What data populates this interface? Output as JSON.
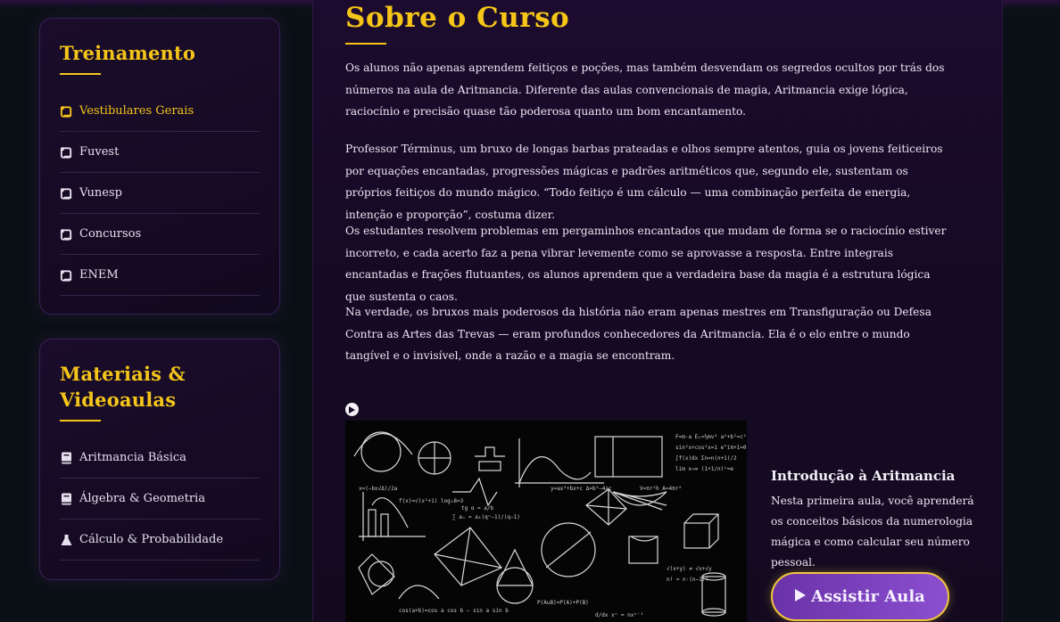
{
  "sidebar": {
    "training": {
      "title": "Treinamento",
      "items": [
        {
          "label": "Vestibulares Gerais",
          "icon": "scroll-icon",
          "active": true
        },
        {
          "label": "Fuvest",
          "icon": "scroll-icon"
        },
        {
          "label": "Vunesp",
          "icon": "scroll-icon"
        },
        {
          "label": "Concursos",
          "icon": "scroll-icon"
        },
        {
          "label": "ENEM",
          "icon": "scroll-icon"
        }
      ]
    },
    "materials": {
      "title": "Materiais & Videoaulas",
      "items": [
        {
          "label": "Aritmancia Básica",
          "icon": "book-icon"
        },
        {
          "label": "Álgebra & Geometria",
          "icon": "book-icon"
        },
        {
          "label": "Cálculo & Probabilidade",
          "icon": "flask-icon"
        }
      ]
    }
  },
  "main": {
    "title": "Sobre o Curso",
    "paragraphs": [
      "Os alunos não apenas aprendem feitiços e poções, mas também desvendam os segredos ocultos por trás dos números na aula de Aritmancia. Diferente das aulas convencionais de magia, Aritmancia exige lógica, raciocínio e precisão quase tão poderosa quanto um bom encantamento.",
      "Professor Términus, um bruxo de longas barbas prateadas e olhos sempre atentos, guia os jovens feiticeiros por equações encantadas, progressões mágicas e padrões aritméticos que, segundo ele, sustentam os próprios feitiços do mundo mágico. “Todo feitiço é um cálculo — uma combinação perfeita de energia, intenção e proporção”, costuma dizer.",
      "Os estudantes resolvem problemas em pergaminhos encantados que mudam de forma se o raciocínio estiver incorreto, e cada acerto faz a pena vibrar levemente como se aprovasse a resposta. Entre integrais encantadas e frações flutuantes, os alunos aprendem que a verdadeira base da magia é a estrutura lógica que sustenta o caos.",
      "Na verdade, os bruxos mais poderosos da história não eram apenas mestres em Transfiguração ou Defesa Contra as Artes das Trevas — eram profundos conhecedores da Aritmancia. Ela é o elo entre o mundo tangível e o invisível, onde a razão e a magia se encontram."
    ],
    "lesson": {
      "title": "Introdução à Aritmancia",
      "description": "Nesta primeira aula, você aprenderá os conceitos básicos da numerologia mágica e como calcular seu número pessoal.",
      "button_label": "Assistir Aula"
    }
  },
  "colors": {
    "accent": "#f5c518",
    "button": "#7b40bd",
    "panel": "#1a0c2b"
  }
}
